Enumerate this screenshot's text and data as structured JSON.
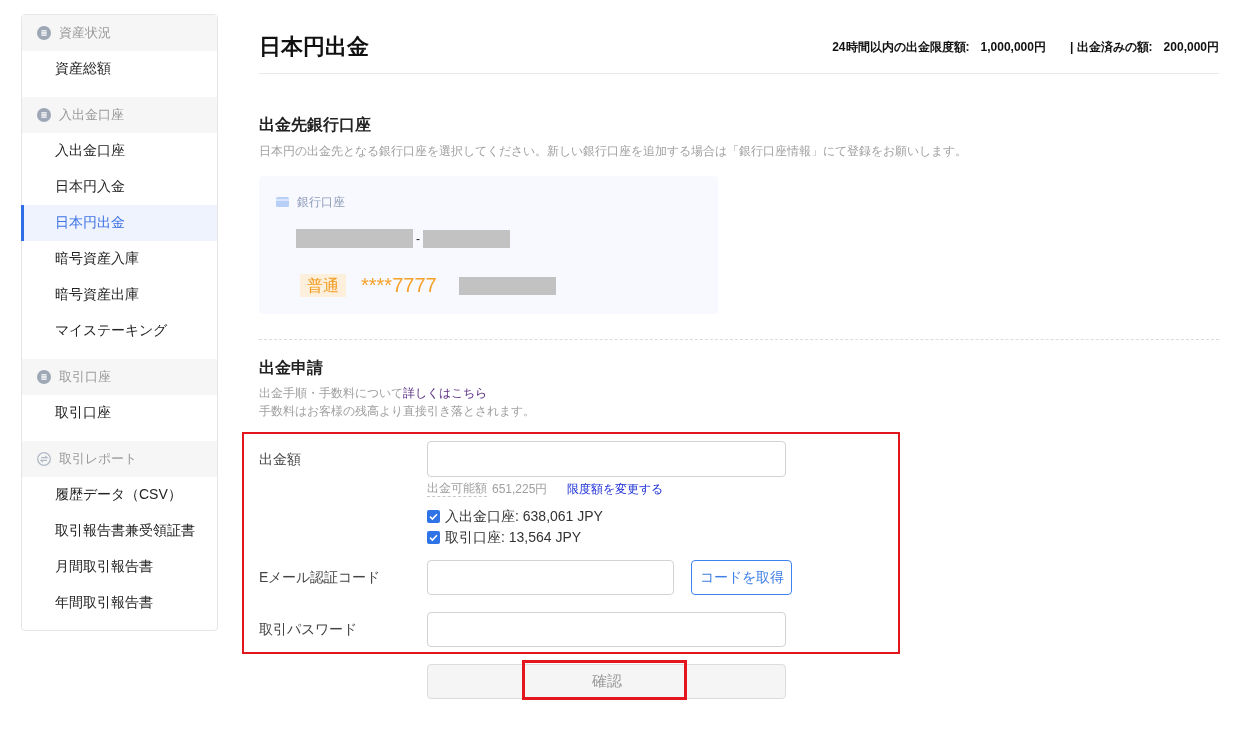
{
  "sidebar": {
    "groups": [
      {
        "label": "資産状況",
        "kind": "list",
        "items": [
          {
            "label": "資産総額",
            "selected": false
          }
        ]
      },
      {
        "label": "入出金口座",
        "kind": "list",
        "items": [
          {
            "label": "入出金口座",
            "selected": false
          },
          {
            "label": "日本円入金",
            "selected": false
          },
          {
            "label": "日本円出金",
            "selected": true
          },
          {
            "label": "暗号資産入庫",
            "selected": false
          },
          {
            "label": "暗号資産出庫",
            "selected": false
          },
          {
            "label": "マイステーキング",
            "selected": false
          }
        ]
      },
      {
        "label": "取引口座",
        "kind": "list",
        "items": [
          {
            "label": "取引口座",
            "selected": false
          }
        ]
      },
      {
        "label": "取引レポート",
        "kind": "exchange",
        "items": [
          {
            "label": "履歴データ（CSV）",
            "selected": false
          },
          {
            "label": "取引報告書兼受領証書",
            "selected": false
          },
          {
            "label": "月間取引報告書",
            "selected": false
          },
          {
            "label": "年間取引報告書",
            "selected": false
          }
        ]
      }
    ]
  },
  "header": {
    "title": "日本円出金",
    "limits": [
      {
        "label": "24時間以内の出金限度額:",
        "value": "1,000,000円"
      },
      {
        "label": "| 出金済みの額:",
        "value": "200,000円"
      }
    ]
  },
  "bank_section": {
    "title": "出金先銀行口座",
    "description": "日本円の出金先となる銀行口座を選択してください。新しい銀行口座を追加する場合は「銀行口座情報」にて登録をお願いします。",
    "card": {
      "label": "銀行口座",
      "name_separator": "-",
      "account_type": "普通",
      "account_number": "****7777"
    }
  },
  "request_section": {
    "title": "出金申請",
    "note": "出金手順・手数料について",
    "note_link": "詳しくはこちら",
    "fee_note": "手数料はお客様の残高より直接引き落とされます。"
  },
  "form": {
    "highlighted": true,
    "amount": {
      "label": "出金額",
      "available_label": "出金可能額",
      "available_value": "651,225円",
      "limit_link": "限度額を変更する",
      "sources": [
        {
          "label": "入出金口座: 638,061 JPY",
          "checked": true
        },
        {
          "label": "取引口座: 13,564 JPY",
          "checked": true
        }
      ]
    },
    "email_code": {
      "label": "Eメール認証コード",
      "button": "コードを取得"
    },
    "password": {
      "label": "取引パスワード"
    }
  },
  "confirm_button": {
    "label": "確認",
    "disabled": true,
    "highlighted": true
  }
}
